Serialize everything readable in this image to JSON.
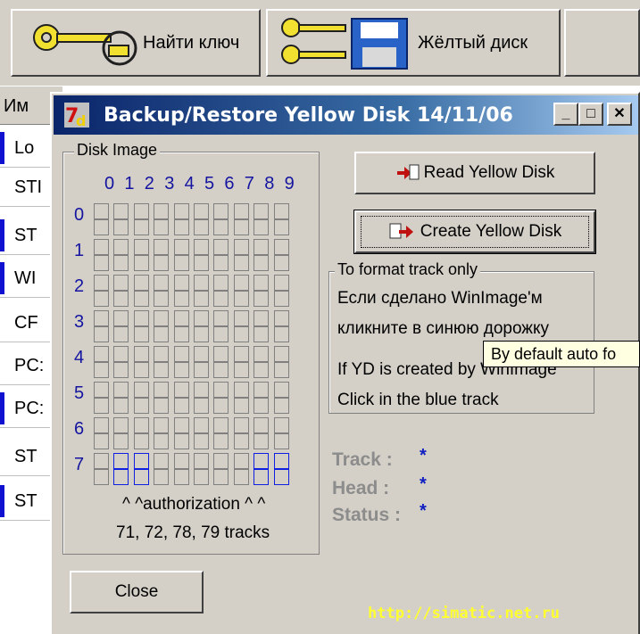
{
  "toolbar": {
    "find_key_label": "Найти ключ",
    "find_key_icon": "key-icon",
    "yellow_disk_label": "Жёлтый диск",
    "yellow_disk_icon": "floppy-key-icon"
  },
  "list": {
    "header": "Им",
    "rows": [
      "Lo",
      "STI",
      "ST",
      "WI",
      "CF",
      "PC:",
      "PC:",
      "ST",
      "ST"
    ]
  },
  "dialog": {
    "title": "Backup/Restore Yellow Disk 14/11/06",
    "minimize_label": "_",
    "maximize_label": "□",
    "close_x_label": "✕",
    "disk_image_legend": "Disk Image",
    "col_numbers": [
      "0",
      "1",
      "2",
      "3",
      "4",
      "5",
      "6",
      "7",
      "8",
      "9"
    ],
    "row_numbers": [
      "0",
      "1",
      "2",
      "3",
      "4",
      "5",
      "6",
      "7"
    ],
    "blue_cells": [
      [
        7,
        1
      ],
      [
        7,
        2
      ],
      [
        7,
        8
      ],
      [
        7,
        9
      ]
    ],
    "authorization_note": "^ ^authorization ^ ^",
    "tracks_note": "71, 72, 78, 79 tracks",
    "read_button": "Read Yellow Disk",
    "create_button": "Create Yellow Disk",
    "format_legend": "To format track only",
    "ru_line1": "Если сделано WinImage'м",
    "ru_line2": "кликните в синюю дорожку",
    "en_line1": "If YD is created by WinImage",
    "en_line2": "Click in the blue track",
    "track_label": "Track :",
    "track_value": "*",
    "head_label": "Head :",
    "head_value": "*",
    "status_label": "Status :",
    "status_value": "*",
    "close_button": "Close",
    "url": "http://simatic.net.ru",
    "tooltip": "By default auto fo"
  }
}
